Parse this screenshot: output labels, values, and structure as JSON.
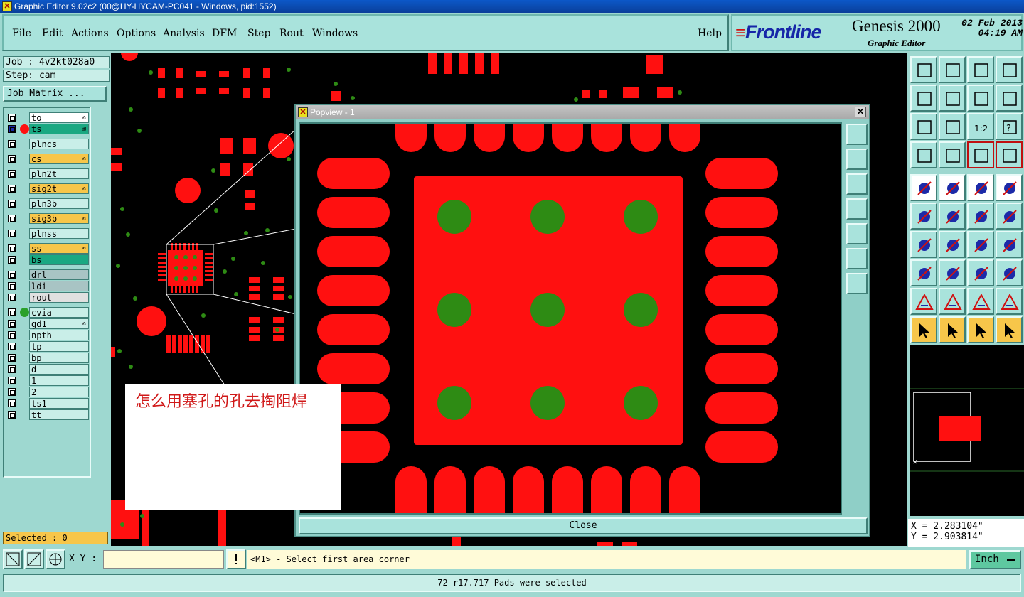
{
  "window": {
    "title": "Graphic Editor 9.02c2 (00@HY-HYCAM-PC041 - Windows, pid:1552)"
  },
  "menu": {
    "items": [
      "File",
      "Edit",
      "Actions",
      "Options",
      "Analysis",
      "DFM",
      "Step",
      "Rout",
      "Windows"
    ],
    "help": "Help"
  },
  "brand": {
    "logo": "Frontline",
    "product": "Genesis 2000",
    "subtitle": "Graphic Editor",
    "date": "02 Feb 2013",
    "time": "04:19 AM"
  },
  "job": {
    "job_label": "Job : 4v2kt028a0",
    "step_label": "Step: cam",
    "matrix_button": "Job Matrix ..."
  },
  "layers": [
    {
      "name": "to",
      "color": "#ffffff",
      "dot": "",
      "mark": "edit"
    },
    {
      "name": "ts",
      "color": "#1aa882",
      "dot": "#ff1010",
      "mark": "grid"
    },
    {
      "name": "plncs",
      "color": "#c9eee8",
      "dot": "",
      "mark": ""
    },
    {
      "name": "cs",
      "color": "#f7c64a",
      "dot": "",
      "mark": "edit"
    },
    {
      "name": "pln2t",
      "color": "#c9eee8",
      "dot": "",
      "mark": ""
    },
    {
      "name": "sig2t",
      "color": "#f7c64a",
      "dot": "",
      "mark": "edit"
    },
    {
      "name": "pln3b",
      "color": "#c9eee8",
      "dot": "",
      "mark": ""
    },
    {
      "name": "sig3b",
      "color": "#f7c64a",
      "dot": "",
      "mark": "edit"
    },
    {
      "name": "plnss",
      "color": "#c9eee8",
      "dot": "",
      "mark": ""
    },
    {
      "name": "ss",
      "color": "#f7c64a",
      "dot": "",
      "mark": "edit"
    },
    {
      "name": "bs",
      "color": "#1aa882",
      "dot": "",
      "mark": ""
    },
    {
      "name": "drl",
      "color": "#a8c4c4",
      "dot": "",
      "mark": ""
    },
    {
      "name": "ldi",
      "color": "#a8c4c4",
      "dot": "",
      "mark": ""
    },
    {
      "name": "rout",
      "color": "#e0e0e0",
      "dot": "",
      "mark": ""
    },
    {
      "name": "cvia",
      "color": "#c9eee8",
      "dot": "#2aa02a",
      "mark": ""
    },
    {
      "name": "gd1",
      "color": "#c9eee8",
      "dot": "",
      "mark": "edit"
    },
    {
      "name": "npth",
      "color": "#c9eee8",
      "dot": "",
      "mark": ""
    },
    {
      "name": "tp",
      "color": "#c9eee8",
      "dot": "",
      "mark": ""
    },
    {
      "name": "bp",
      "color": "#c9eee8",
      "dot": "",
      "mark": ""
    },
    {
      "name": "d",
      "color": "#c9eee8",
      "dot": "",
      "mark": ""
    },
    {
      "name": "1",
      "color": "#c9eee8",
      "dot": "",
      "mark": ""
    },
    {
      "name": "2",
      "color": "#c9eee8",
      "dot": "",
      "mark": ""
    },
    {
      "name": "ts1",
      "color": "#c9eee8",
      "dot": "",
      "mark": ""
    },
    {
      "name": "tt",
      "color": "#c9eee8",
      "dot": "",
      "mark": ""
    }
  ],
  "selected": "Selected : 0",
  "popview": {
    "title": "Popview - 1",
    "close_label": "Close"
  },
  "note": {
    "text": "怎么用塞孔的孔去掏阻焊"
  },
  "coords": {
    "x": "X = 2.283104\"",
    "y": "Y = 2.903814\""
  },
  "command": {
    "xy_label": "X Y :",
    "xy_value": "",
    "prompt": "<M1> - Select first area corner",
    "units": "Inch"
  },
  "status": "72 r17.717 Pads were selected",
  "colors": {
    "pad": "#ff1010",
    "via": "#2e8b14",
    "bg": "#000000",
    "panel": "#9ed8d0"
  }
}
